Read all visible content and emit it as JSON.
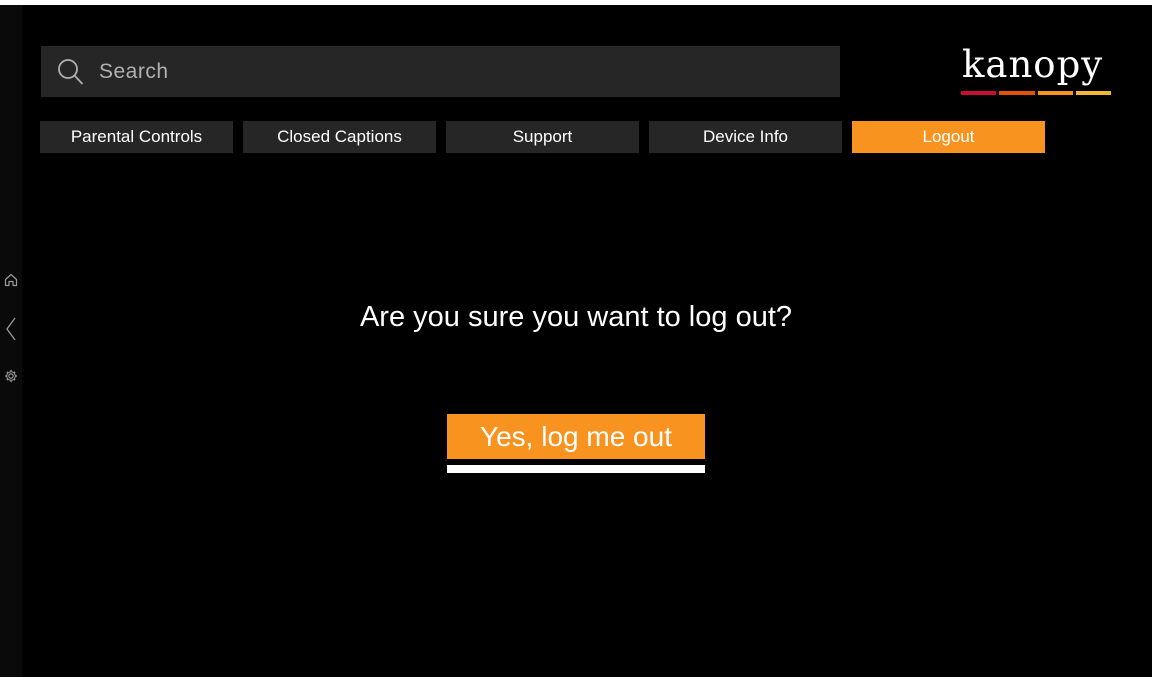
{
  "search": {
    "placeholder": "Search",
    "icon": "search-icon"
  },
  "brand": {
    "logo_text": "kanopy",
    "stripe_colors": [
      "#c8102e",
      "#e35205",
      "#f7931e",
      "#f2b632"
    ]
  },
  "side_nav": {
    "icons": [
      "home-icon",
      "back-chevron-icon",
      "settings-gear-icon"
    ]
  },
  "tabs": [
    {
      "label": "Parental Controls",
      "active": false
    },
    {
      "label": "Closed Captions",
      "active": false
    },
    {
      "label": "Support",
      "active": false
    },
    {
      "label": "Device Info",
      "active": false
    },
    {
      "label": "Logout",
      "active": true
    }
  ],
  "dialog": {
    "question": "Are you sure you want to log out?",
    "confirm_label": "Yes, log me out"
  },
  "colors": {
    "accent": "#f7931e",
    "background": "#000000",
    "surface": "#262626",
    "text": "#ffffff"
  }
}
